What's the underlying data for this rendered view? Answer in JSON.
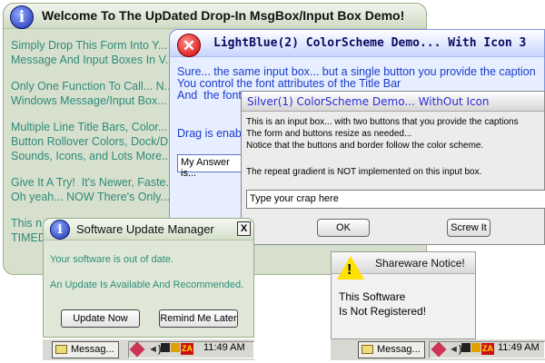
{
  "welcome": {
    "title": "Welcome To The UpDated Drop-In MsgBox/Input Box Demo!",
    "paragraphs": [
      "Simply Drop This Form Into Y...\nMessage And Input Boxes In V...",
      "Only One Function To Call... N...\nWindows Message/Input Box...",
      "Multiple Line Title Bars, Color...\nButton Rollover Colors, Dock/D...\nSounds, Icons, and Lots More...",
      "Give It A Try!  It's Newer, Faste...\nOh yeah... NOW There's Only...",
      "This n...\nTIMED..."
    ]
  },
  "lightblue": {
    "title": "LightBlue(2) ColorScheme Demo... With Icon 3",
    "message": "Sure... the same input box... but a single button you provide the caption\nYou control the font attributes of the Title Bar\nAnd  the font...",
    "drag_text": "Drag is enab...",
    "input_value": "My Answer is..."
  },
  "silver": {
    "title": "Silver(1) ColorScheme Demo... WithOut Icon",
    "message": "This is an input box... with two buttons that you provide the captions\nThe form and buttons resize as needed...\nNotice that the buttons and border follow the color scheme.",
    "note": "The repeat gradient is NOT implemented on this input box.",
    "input_value": "Type your crap here",
    "ok_label": "OK",
    "screw_label": "Screw It"
  },
  "update": {
    "title": "Software Update Manager",
    "close_label": "X",
    "line1": "Your software is out of date.",
    "line2": "An Update Is Available And Recommended.",
    "update_label": "Update Now",
    "remind_label": "Remind Me Later"
  },
  "shareware": {
    "title": "Shareware Notice!",
    "line1": "This Software",
    "line2": "Is Not Registered!"
  },
  "taskbar": {
    "task_label": "Messag...",
    "time": "11:49 AM"
  },
  "colors": {
    "welcome_text": "#2e8a7a",
    "lightblue_text": "#1a3ccf",
    "silver_title": "#2b2bd6"
  }
}
